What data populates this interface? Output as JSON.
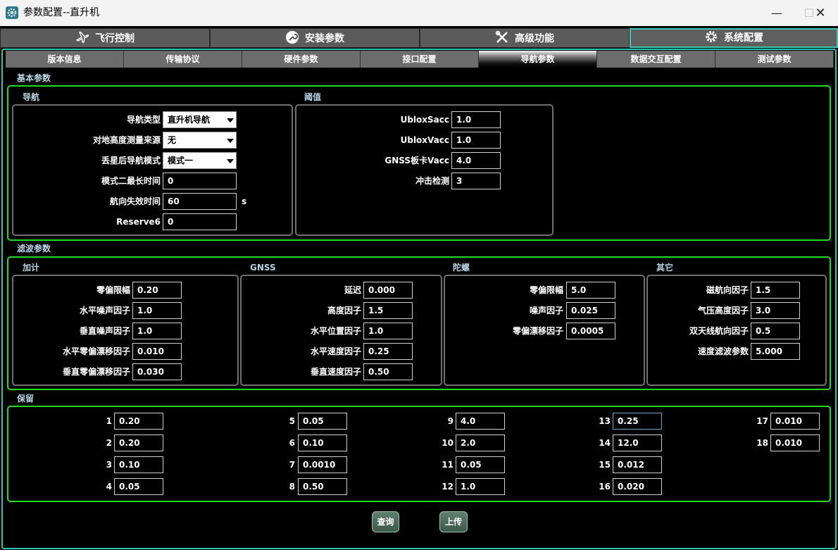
{
  "window": {
    "title": "参数配置--直升机",
    "min_glyph": "—",
    "max_glyph": "☐",
    "close_glyph": "✕"
  },
  "main_tabs": [
    {
      "label": "飞行控制",
      "icon": "airplane-icon"
    },
    {
      "label": "安装参数",
      "icon": "wrench-icon"
    },
    {
      "label": "高级功能",
      "icon": "tools-icon"
    },
    {
      "label": "系统配置",
      "icon": "gear-icon",
      "active": true
    }
  ],
  "sub_tabs": [
    "版本信息",
    "传输协议",
    "硬件参数",
    "接口配置",
    "导航参数",
    "数据交互配置",
    "测试参数"
  ],
  "active_sub_tab": "导航参数",
  "basic": {
    "label": "基本参数",
    "nav": {
      "label": "导航",
      "nav_type": {
        "label": "导航类型",
        "value": "直升机导航"
      },
      "alt_source": {
        "label": "对地高度测量来源",
        "value": "无"
      },
      "loss_mode": {
        "label": "丢星后导航模式",
        "value": "模式一"
      },
      "mode2_time": {
        "label": "模式二最长时间",
        "value": "0"
      },
      "heading_fail": {
        "label": "航向失效时间",
        "value": "60",
        "unit": "s"
      },
      "reserve6": {
        "label": "Reserve6",
        "value": "0"
      }
    },
    "threshold": {
      "label": "阈值",
      "ublox_sacc": {
        "label": "UbloxSacc",
        "value": "1.0"
      },
      "ublox_vacc": {
        "label": "UbloxVacc",
        "value": "1.0"
      },
      "gnss_vacc": {
        "label": "GNSS板卡Vacc",
        "value": "4.0"
      },
      "impact": {
        "label": "冲击检测",
        "value": "3"
      }
    }
  },
  "filter": {
    "label": "滤波参数",
    "accel": {
      "label": "加计",
      "bias_limit": {
        "label": "零偏限幅",
        "value": "0.20"
      },
      "h_noise": {
        "label": "水平噪声因子",
        "value": "1.0"
      },
      "v_noise": {
        "label": "垂直噪声因子",
        "value": "1.0"
      },
      "h_bias_drift": {
        "label": "水平零偏漂移因子",
        "value": "0.010"
      },
      "v_bias_drift": {
        "label": "垂直零偏漂移因子",
        "value": "0.030"
      }
    },
    "gnss": {
      "label": "GNSS",
      "delay": {
        "label": "延迟",
        "value": "0.000"
      },
      "height": {
        "label": "高度因子",
        "value": "1.5"
      },
      "h_pos": {
        "label": "水平位置因子",
        "value": "1.0"
      },
      "h_vel": {
        "label": "水平速度因子",
        "value": "0.25"
      },
      "v_vel": {
        "label": "垂直速度因子",
        "value": "0.50"
      }
    },
    "gyro": {
      "label": "陀螺",
      "bias_limit": {
        "label": "零偏限幅",
        "value": "5.0"
      },
      "noise": {
        "label": "噪声因子",
        "value": "0.025"
      },
      "bias_drift": {
        "label": "零偏漂移因子",
        "value": "0.0005"
      }
    },
    "other": {
      "label": "其它",
      "mag_heading": {
        "label": "磁航向因子",
        "value": "1.5"
      },
      "baro_height": {
        "label": "气压高度因子",
        "value": "3.0"
      },
      "dual_antenna": {
        "label": "双天线航向因子",
        "value": "0.5"
      },
      "speed_filter": {
        "label": "速度滤波参数",
        "value": "5.000"
      }
    }
  },
  "reserved": {
    "label": "保留",
    "items": [
      {
        "index": "1",
        "value": "0.20"
      },
      {
        "index": "2",
        "value": "0.20"
      },
      {
        "index": "3",
        "value": "0.10"
      },
      {
        "index": "4",
        "value": "0.05"
      },
      {
        "index": "5",
        "value": "0.05"
      },
      {
        "index": "6",
        "value": "0.10"
      },
      {
        "index": "7",
        "value": "0.0010"
      },
      {
        "index": "8",
        "value": "0.50"
      },
      {
        "index": "9",
        "value": "4.0"
      },
      {
        "index": "10",
        "value": "2.0"
      },
      {
        "index": "11",
        "value": "0.05"
      },
      {
        "index": "12",
        "value": "1.0"
      },
      {
        "index": "13",
        "value": "0.25"
      },
      {
        "index": "14",
        "value": "12.0"
      },
      {
        "index": "15",
        "value": "0.012"
      },
      {
        "index": "16",
        "value": "0.020"
      },
      {
        "index": "17",
        "value": "0.010"
      },
      {
        "index": "18",
        "value": "0.010"
      }
    ]
  },
  "actions": {
    "query": "查询",
    "upload": "上传"
  },
  "colors": {
    "group_border": "#20dc20",
    "accent": "#28c8b4",
    "tab_bg": "#5b5b5b",
    "subtab_bg": "#6c6c6c",
    "section_label": "#b9d6e8"
  }
}
